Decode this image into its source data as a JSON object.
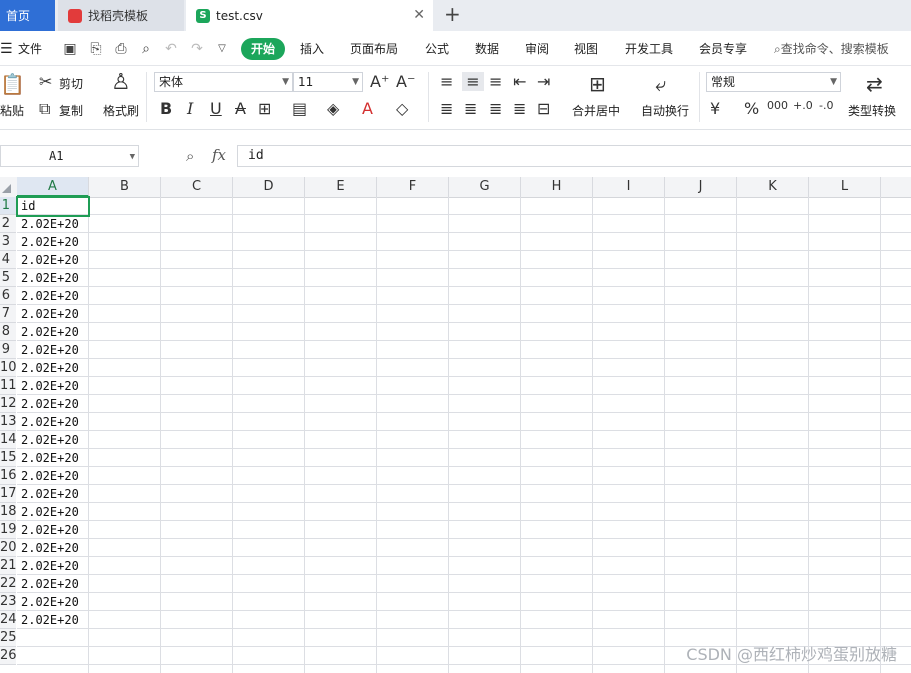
{
  "tabs": {
    "home": "首页",
    "template": "找稻壳模板",
    "file": "test.csv"
  },
  "menu": {
    "file": "文件",
    "start": "开始",
    "insert": "插入",
    "layout": "页面布局",
    "formula": "公式",
    "data": "数据",
    "review": "审阅",
    "view": "视图",
    "dev": "开发工具",
    "member": "会员专享",
    "search": "查找命令、搜索模板"
  },
  "ribbon": {
    "paste": "粘贴",
    "cut": "剪切",
    "copy": "复制",
    "format_painter": "格式刷",
    "font_name": "宋体",
    "font_size": "11",
    "merge_center": "合并居中",
    "wrap_text": "自动换行",
    "number_format": "常规",
    "convert_type": "类型转换"
  },
  "formula_bar": {
    "name_box": "A1",
    "fx": "fx",
    "content": "id"
  },
  "columns": [
    "A",
    "B",
    "C",
    "D",
    "E",
    "F",
    "G",
    "H",
    "I",
    "J",
    "K",
    "L"
  ],
  "row_numbers": [
    "1",
    "2",
    "3",
    "4",
    "5",
    "6",
    "7",
    "8",
    "9",
    "10",
    "11",
    "12",
    "13",
    "14",
    "15",
    "16",
    "17",
    "18",
    "19",
    "20",
    "21",
    "22",
    "23",
    "24",
    "25",
    "26"
  ],
  "column_a": [
    "id",
    "2.02E+20",
    "2.02E+20",
    "2.02E+20",
    "2.02E+20",
    "2.02E+20",
    "2.02E+20",
    "2.02E+20",
    "2.02E+20",
    "2.02E+20",
    "2.02E+20",
    "2.02E+20",
    "2.02E+20",
    "2.02E+20",
    "2.02E+20",
    "2.02E+20",
    "2.02E+20",
    "2.02E+20",
    "2.02E+20",
    "2.02E+20",
    "2.02E+20",
    "2.02E+20",
    "2.02E+20",
    "2.02E+20",
    "",
    ""
  ],
  "watermark": "CSDN @西红柿炒鸡蛋别放糖",
  "colors": {
    "accent_blue": "#2f6fd6",
    "accent_green": "#1ca65b",
    "selection": "#1f9d55"
  }
}
